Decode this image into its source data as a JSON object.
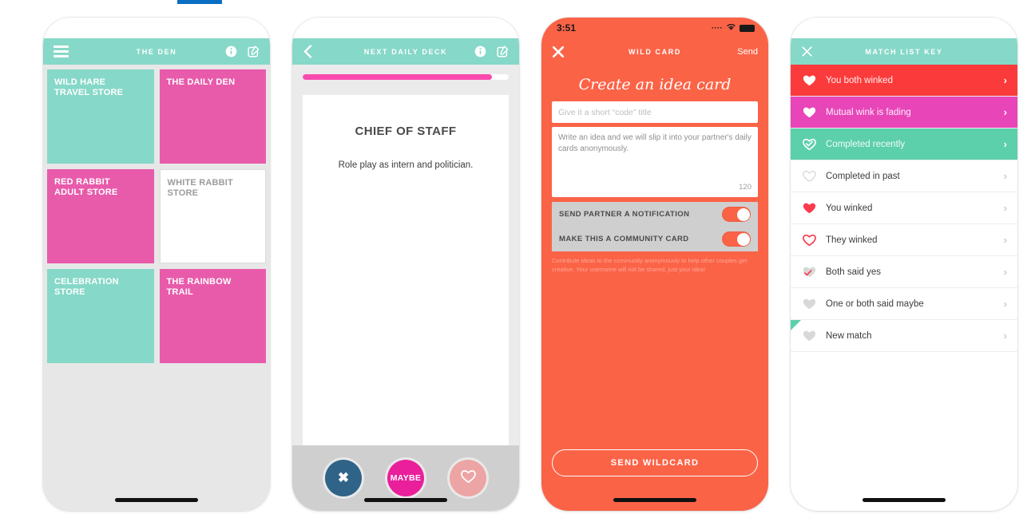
{
  "phones": [
    {
      "id": "den",
      "status_bar": {
        "visible": false,
        "time": "",
        "battery_icon": "battery-icon",
        "wifi_icon": "wifi-icon"
      },
      "navbar": {
        "title": "THE DEN",
        "left_icon": "hamburger-menu-icon",
        "right_icons": [
          "info-icon",
          "compose-icon"
        ],
        "bg": "#86d8c8"
      },
      "tiles": [
        {
          "label": "WILD HARE\nTRAVEL STORE",
          "style": "teal"
        },
        {
          "label": "THE DAILY DEN",
          "style": "pink"
        },
        {
          "label": "RED RABBIT\nADULT STORE",
          "style": "pink"
        },
        {
          "label": "WHITE RABBIT STORE",
          "style": "white"
        },
        {
          "label": "CELEBRATION STORE",
          "style": "teal"
        },
        {
          "label": "THE RAINBOW TRAIL",
          "style": "pink"
        }
      ]
    },
    {
      "id": "deck",
      "status_bar": {
        "visible": false
      },
      "navbar": {
        "title": "NEXT DAILY DECK",
        "left_icon": "back-chevron-icon",
        "right_icons": [
          "info-icon",
          "compose-icon"
        ],
        "bg": "#86d8c8"
      },
      "progress": {
        "percent": 92,
        "fill_color": "#fa4bad",
        "track_color": "#ffffff"
      },
      "card": {
        "title": "CHIEF OF STAFF",
        "subtitle": "Role play as intern and politician."
      },
      "actions": [
        {
          "name": "no-button",
          "label": "✖",
          "icon": "x-icon",
          "color": "#2f6388"
        },
        {
          "name": "maybe-button",
          "label": "MAYBE",
          "icon": "maybe-text",
          "color": "#ea1f9b"
        },
        {
          "name": "yes-button",
          "label": "♡",
          "icon": "heart-outline-icon",
          "color": "#eda4a4"
        }
      ]
    },
    {
      "id": "wildcard",
      "status_bar": {
        "visible": true,
        "time": "3:51",
        "signal_icon": "signal-dots-icon",
        "wifi_icon": "wifi-icon",
        "battery_icon": "battery-icon"
      },
      "navbar": {
        "title": "WILD CARD",
        "left_icon": "close-x-icon",
        "right_label": "Send",
        "bg": "#fb6347"
      },
      "heading": "Create an idea card",
      "title_input": {
        "placeholder": "Give it a short “code” title",
        "value": ""
      },
      "idea_textarea": {
        "placeholder": "Write an idea and we will slip it into your partner's daily cards anonymously.",
        "value": "",
        "counter": "120"
      },
      "toggles": [
        {
          "label": "SEND PARTNER A NOTIFICATION",
          "on": true
        },
        {
          "label": "MAKE THIS A COMMUNITY CARD",
          "on": true
        }
      ],
      "fineprint": "Contribute ideas to the community anonymously to help other couples get creative. Your username will not be shared, just your idea!",
      "submit_label": "SEND WILDCARD"
    },
    {
      "id": "matchkey",
      "status_bar": {
        "visible": false
      },
      "navbar": {
        "title": "MATCH LIST KEY",
        "left_icon": "close-x-icon",
        "bg": "#86d8c8"
      },
      "rows": [
        {
          "label": "You both winked",
          "row_style": "row-red",
          "icon": "heart-filled-icon",
          "icon_color": "#ffffff",
          "chevron": "›",
          "corner": false
        },
        {
          "label": "Mutual wink is fading",
          "row_style": "row-pink",
          "icon": "heart-filled-icon",
          "icon_color": "#ffffff",
          "chevron": "›",
          "corner": false
        },
        {
          "label": "Completed recently",
          "row_style": "row-teal",
          "icon": "heart-check-icon",
          "icon_color": "#ffffff",
          "chevron": "›",
          "corner": false
        },
        {
          "label": "Completed in past",
          "row_style": "row-plain",
          "icon": "heart-outline-icon",
          "icon_color": "#e0e0e0",
          "chevron": "›",
          "corner": false
        },
        {
          "label": "You winked",
          "row_style": "row-plain",
          "icon": "heart-filled-icon",
          "icon_color": "#fb3b4e",
          "chevron": "›",
          "corner": false
        },
        {
          "label": "They winked",
          "row_style": "row-plain",
          "icon": "heart-outline-icon",
          "icon_color": "#fb3b4e",
          "chevron": "›",
          "corner": false
        },
        {
          "label": "Both said yes",
          "row_style": "row-plain",
          "icon": "heart-check-gray-icon",
          "icon_color": "#d8d8d8",
          "chevron": "›",
          "corner": false
        },
        {
          "label": "One or both said maybe",
          "row_style": "row-plain",
          "icon": "heart-filled-icon",
          "icon_color": "#d8d8d8",
          "chevron": "›",
          "corner": false
        },
        {
          "label": "New match",
          "row_style": "row-plain",
          "icon": "heart-filled-icon",
          "icon_color": "#d8d8d8",
          "chevron": "›",
          "corner": true
        }
      ]
    }
  ],
  "colors": {
    "teal": "#86d8c8",
    "pink": "#e85bab",
    "orange": "#fb6347",
    "hot_pink": "#fa4bad",
    "red": "#fb3b3b",
    "magenta": "#e845b9",
    "green_teal": "#5ccfab",
    "blue_bar": "#0a6fc2"
  }
}
